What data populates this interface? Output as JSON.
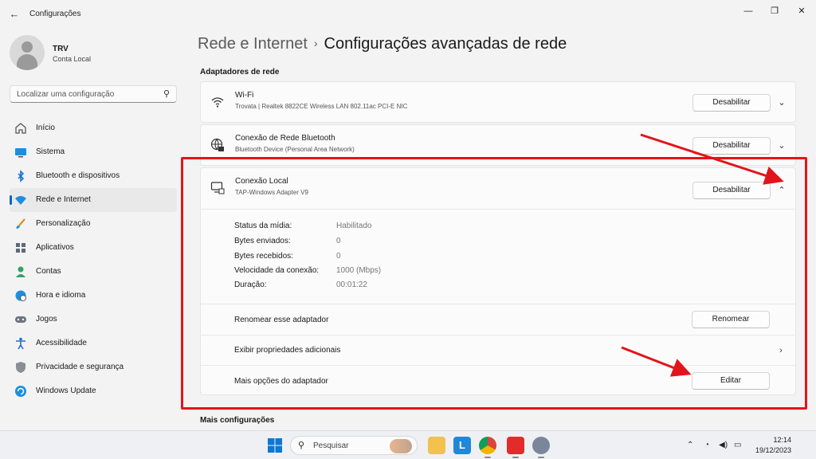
{
  "window": {
    "title": "Configurações",
    "back_icon": "arrow-left-icon",
    "controls": [
      "minimize",
      "restore",
      "close"
    ]
  },
  "profile": {
    "name": "TRV",
    "subtitle": "Conta Local"
  },
  "search": {
    "placeholder": "Localizar uma configuração",
    "icon": "search-icon"
  },
  "nav": {
    "items": [
      {
        "label": "Início",
        "icon": "home-icon",
        "active": false
      },
      {
        "label": "Sistema",
        "icon": "monitor-icon",
        "active": false
      },
      {
        "label": "Bluetooth e dispositivos",
        "icon": "bluetooth-icon",
        "active": false
      },
      {
        "label": "Rede e Internet",
        "icon": "wifi-icon",
        "active": true
      },
      {
        "label": "Personalização",
        "icon": "brush-icon",
        "active": false
      },
      {
        "label": "Aplicativos",
        "icon": "apps-icon",
        "active": false
      },
      {
        "label": "Contas",
        "icon": "person-icon",
        "active": false
      },
      {
        "label": "Hora e idioma",
        "icon": "globe-clock-icon",
        "active": false
      },
      {
        "label": "Jogos",
        "icon": "gamepad-icon",
        "active": false
      },
      {
        "label": "Acessibilidade",
        "icon": "accessibility-icon",
        "active": false
      },
      {
        "label": "Privacidade e segurança",
        "icon": "shield-icon",
        "active": false
      },
      {
        "label": "Windows Update",
        "icon": "update-icon",
        "active": false
      }
    ]
  },
  "breadcrumb": {
    "parent": "Rede e Internet",
    "separator": "›",
    "current": "Configurações avançadas de rede"
  },
  "sections": {
    "adapters_title": "Adaptadores de rede",
    "more_title": "Mais configurações"
  },
  "adapters": [
    {
      "name": "Wi-Fi",
      "description": "Trovata | Realtek 8822CE Wireless LAN 802.11ac PCI-E NIC",
      "button": "Desabilitar",
      "icon": "wifi-icon",
      "expanded": false
    },
    {
      "name": "Conexão de Rede Bluetooth",
      "description": "Bluetooth Device (Personal Area Network)",
      "button": "Desabilitar",
      "icon": "globe-network-icon",
      "expanded": false
    },
    {
      "name": "Conexão Local",
      "description": "TAP-Windows Adapter V9",
      "button": "Desabilitar",
      "icon": "ethernet-monitor-icon",
      "expanded": true
    }
  ],
  "details": [
    {
      "label": "Status da mídia:",
      "value": "Habilitado"
    },
    {
      "label": "Bytes enviados:",
      "value": "0"
    },
    {
      "label": "Bytes recebidos:",
      "value": "0"
    },
    {
      "label": "Velocidade da conexão:",
      "value": "1000 (Mbps)"
    },
    {
      "label": "Duração:",
      "value": "00:01:22"
    }
  ],
  "actions": {
    "rename": {
      "label": "Renomear esse adaptador",
      "button": "Renomear"
    },
    "properties": {
      "label": "Exibir propriedades adicionais"
    },
    "more_options": {
      "label": "Mais opções do adaptador",
      "button": "Editar"
    }
  },
  "annotation_color": "#e3141b",
  "accent_color": "#0067c0",
  "taskbar": {
    "search_placeholder": "Pesquisar",
    "apps": [
      "windows-start-icon",
      "file-explorer-icon",
      "l-app-icon",
      "chrome-icon",
      "anydesk-icon",
      "settings-gear-icon"
    ],
    "tray": [
      "chevron-up-icon",
      "wifi-icon",
      "volume-icon",
      "battery-icon"
    ],
    "time": "12:14",
    "date": "19/12/2023"
  }
}
